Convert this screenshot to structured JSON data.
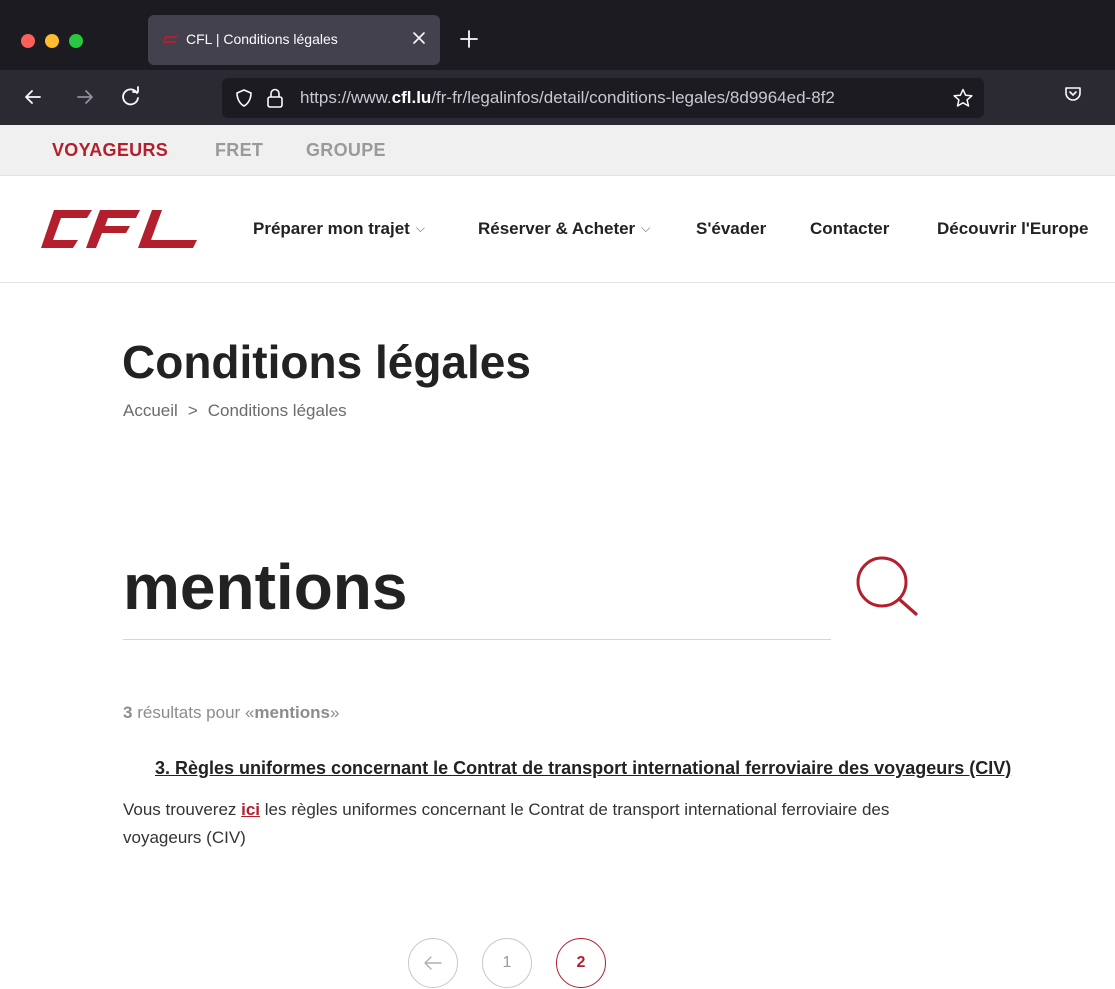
{
  "browser": {
    "tab_title": "CFL | Conditions légales",
    "url_prefix": "https://www.",
    "url_domain": "cfl.lu",
    "url_path": "/fr-fr/legalinfos/detail/conditions-legales/8d9964ed-8f2"
  },
  "site": {
    "brand_color": "#b41f2e",
    "logo_text": "CFL",
    "top_nav": [
      "VOYAGEURS",
      "FRET",
      "GROUPE"
    ],
    "main_nav": [
      {
        "label": "Préparer mon trajet",
        "icon": "chevron-down-icon"
      },
      {
        "label": "Réserver & Acheter",
        "icon": "chevron-down-icon"
      },
      {
        "label": "S'évader"
      },
      {
        "label": "Contacter"
      },
      {
        "label": "Découvrir l'Europe"
      }
    ]
  },
  "page": {
    "title": "Conditions légales",
    "breadcrumb": [
      "Accueil",
      ">",
      "Conditions légales"
    ]
  },
  "search": {
    "value": "mentions",
    "icon": "search-icon"
  },
  "results": {
    "count": "3",
    "label": "résultats pour",
    "open_quote": "«",
    "term": "mentions",
    "close_quote": "»",
    "items": [
      {
        "title": "3. Règles uniformes concernant le Contrat de transport international ferroviaire des voyageurs (CIV)",
        "desc_before": "Vous trouverez ",
        "link": "ici",
        "desc_after": " les règles uniformes concernant le Contrat de transport international ferroviaire des voyageurs (CIV)"
      }
    ]
  },
  "pagination": {
    "pages": [
      "1",
      "2"
    ],
    "current": "2"
  }
}
